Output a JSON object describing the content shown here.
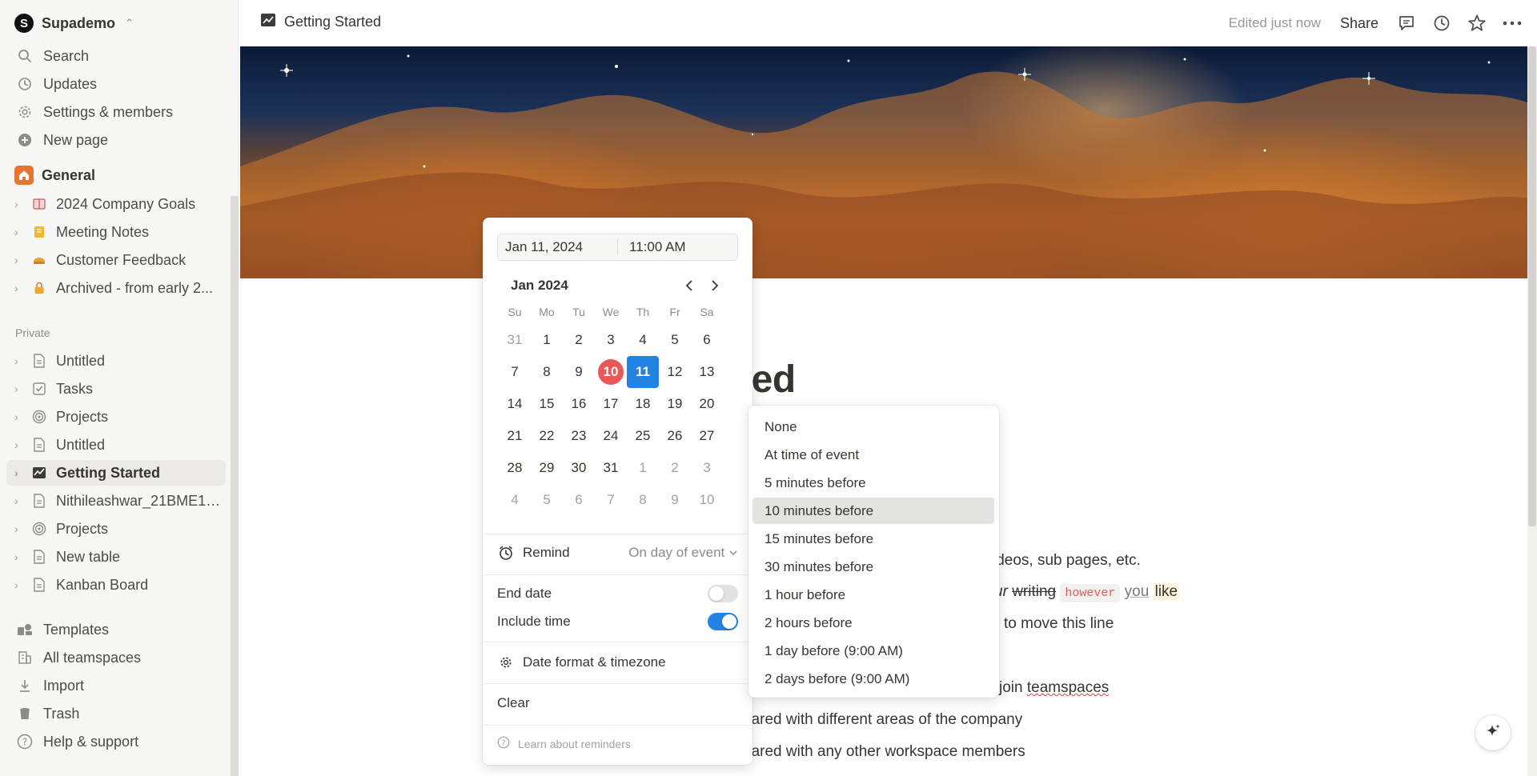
{
  "workspace": {
    "avatar_letter": "S",
    "name": "Supademo"
  },
  "sidebar": {
    "nav": [
      {
        "label": "Search",
        "icon": "search-icon"
      },
      {
        "label": "Updates",
        "icon": "clock-icon"
      },
      {
        "label": "Settings & members",
        "icon": "gear-icon"
      },
      {
        "label": "New page",
        "icon": "plus-circle-icon"
      }
    ],
    "teamspace": {
      "label": "General",
      "icon": "home-icon",
      "color": "#e9742f"
    },
    "teamspace_pages": [
      {
        "label": "2024 Company Goals",
        "icon": "book-icon"
      },
      {
        "label": "Meeting Notes",
        "icon": "notebook-icon"
      },
      {
        "label": "Customer Feedback",
        "icon": "pie-icon"
      },
      {
        "label": "Archived - from early 2...",
        "icon": "lock-icon"
      }
    ],
    "private_label": "Private",
    "private_pages": [
      {
        "label": "Untitled",
        "icon": "page-icon"
      },
      {
        "label": "Tasks",
        "icon": "checkbox-icon"
      },
      {
        "label": "Projects",
        "icon": "target-icon"
      },
      {
        "label": "Untitled",
        "icon": "page-icon"
      },
      {
        "label": "Getting Started",
        "icon": "chart-icon",
        "selected": true
      },
      {
        "label": "Nithileashwar_21BME10...",
        "icon": "page-icon"
      },
      {
        "label": "Projects",
        "icon": "target-icon"
      },
      {
        "label": "New table",
        "icon": "page-icon"
      },
      {
        "label": "Kanban Board",
        "icon": "page-icon"
      }
    ],
    "footer": [
      {
        "label": "Templates",
        "icon": "templates-icon"
      },
      {
        "label": "All teamspaces",
        "icon": "building-icon"
      },
      {
        "label": "Import",
        "icon": "download-icon"
      },
      {
        "label": "Trash",
        "icon": "trash-icon"
      },
      {
        "label": "Help & support",
        "icon": "help-icon"
      }
    ]
  },
  "header": {
    "page_title": "Getting Started",
    "edited": "Edited just now",
    "share": "Share"
  },
  "page": {
    "title_visible": "rted",
    "lines": {
      "l1": "ideos, sub pages, etc.",
      "l2_a": "ur",
      "l2_b": "writing",
      "l2_code": "however",
      "l2_c": "you",
      "l2_d": "like",
      "l3": "to move this line",
      "l4_a": "join",
      "l4_b": "teamspaces",
      "l5": "hared with different areas of the company",
      "l6": "hared with any other workspace members"
    }
  },
  "datepicker": {
    "date_value": "Jan 11, 2024",
    "time_value": "11:00 AM",
    "month_label": "Jan 2024",
    "weekdays": [
      "Su",
      "Mo",
      "Tu",
      "We",
      "Th",
      "Fr",
      "Sa"
    ],
    "weeks": [
      [
        "31",
        "1",
        "2",
        "3",
        "4",
        "5",
        "6"
      ],
      [
        "7",
        "8",
        "9",
        "10",
        "11",
        "12",
        "13"
      ],
      [
        "14",
        "15",
        "16",
        "17",
        "18",
        "19",
        "20"
      ],
      [
        "21",
        "22",
        "23",
        "24",
        "25",
        "26",
        "27"
      ],
      [
        "28",
        "29",
        "30",
        "31",
        "1",
        "2",
        "3"
      ],
      [
        "4",
        "5",
        "6",
        "7",
        "8",
        "9",
        "10"
      ]
    ],
    "today": "10",
    "selected": "11",
    "remind_label": "Remind",
    "remind_value": "On day of event",
    "end_date_label": "End date",
    "end_date_on": false,
    "include_time_label": "Include time",
    "include_time_on": true,
    "format_label": "Date format & timezone",
    "clear_label": "Clear",
    "learn_label": "Learn about reminders"
  },
  "remind_options": [
    "None",
    "At time of event",
    "5 minutes before",
    "10 minutes before",
    "15 minutes before",
    "30 minutes before",
    "1 hour before",
    "2 hours before",
    "1 day before (9:00 AM)",
    "2 days before (9:00 AM)"
  ],
  "remind_hovered": "10 minutes before",
  "colors": {
    "accent": "#2383e2",
    "today": "#eb5757",
    "code": "#eb5757"
  }
}
